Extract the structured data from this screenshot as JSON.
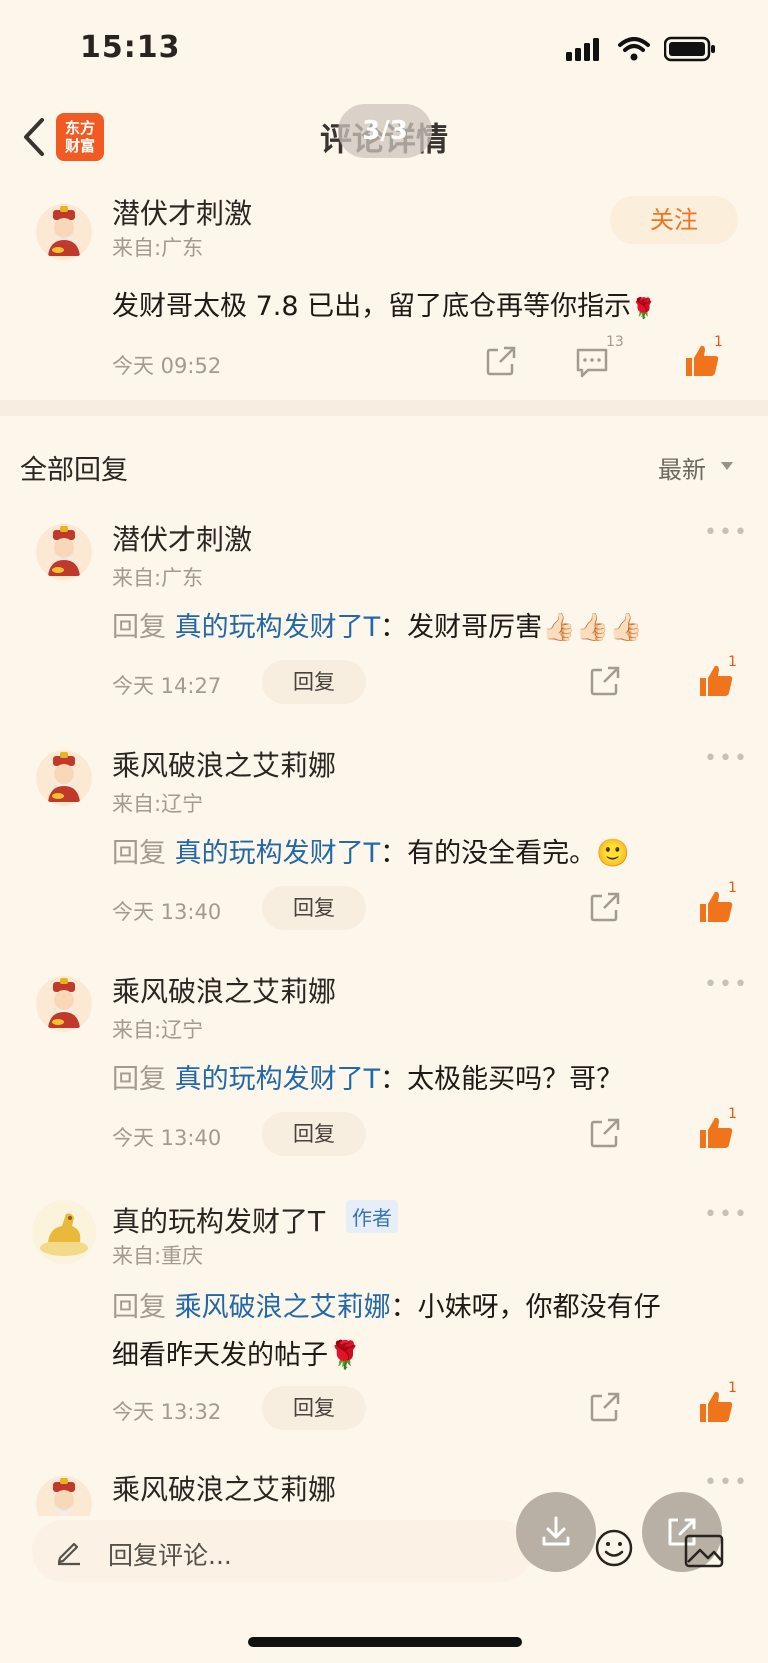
{
  "status_bar": {
    "time": "15:13"
  },
  "nav": {
    "logo_line1": "东方",
    "logo_line2": "财富",
    "title": "评论详情",
    "page_indicator": "3/3"
  },
  "main_comment": {
    "author": "潜伏才刺激",
    "location": "来自:广东",
    "content": "发财哥太极 7.8 已出，留了底仓再等你指示",
    "content_emoji": "🌹",
    "time": "今天 09:52",
    "comment_count": "13",
    "like_count": "1",
    "follow_label": "关注"
  },
  "replies_header": {
    "title": "全部回复",
    "sort": "最新"
  },
  "replies": [
    {
      "author": "潜伏才刺激",
      "location": "来自:广东",
      "reply_prefix": "回复",
      "reply_to": "真的玩构发财了T",
      "separator": "：",
      "content": "发财哥厉害👍🏻👍🏻👍🏻",
      "time": "今天 14:27",
      "reply_label": "回复",
      "like_count": "1"
    },
    {
      "author": "乘风破浪之艾莉娜",
      "location": "来自:辽宁",
      "reply_prefix": "回复",
      "reply_to": "真的玩构发财了T",
      "separator": "：",
      "content": "有的没全看完。🙂",
      "time": "今天 13:40",
      "reply_label": "回复",
      "like_count": "1"
    },
    {
      "author": "乘风破浪之艾莉娜",
      "location": "来自:辽宁",
      "reply_prefix": "回复",
      "reply_to": "真的玩构发财了T",
      "separator": "：",
      "content": "太极能买吗？哥？",
      "time": "今天 13:40",
      "reply_label": "回复",
      "like_count": "1"
    },
    {
      "author": "真的玩构发财了T",
      "author_badge": "作者",
      "location": "来自:重庆",
      "reply_prefix": "回复",
      "reply_to": "乘风破浪之艾莉娜",
      "separator": "：",
      "content_line1": "小妹呀，你都没有仔",
      "content_line2": "细看昨天发的帖子🌹",
      "time": "今天 13:32",
      "reply_label": "回复",
      "like_count": "1"
    },
    {
      "author": "乘风破浪之艾莉娜"
    }
  ],
  "input_bar": {
    "placeholder": "回复评论..."
  },
  "colors": {
    "background": "#fdf6ea",
    "accent": "#f0741c",
    "link": "#2368a8",
    "muted": "#a39a90"
  }
}
